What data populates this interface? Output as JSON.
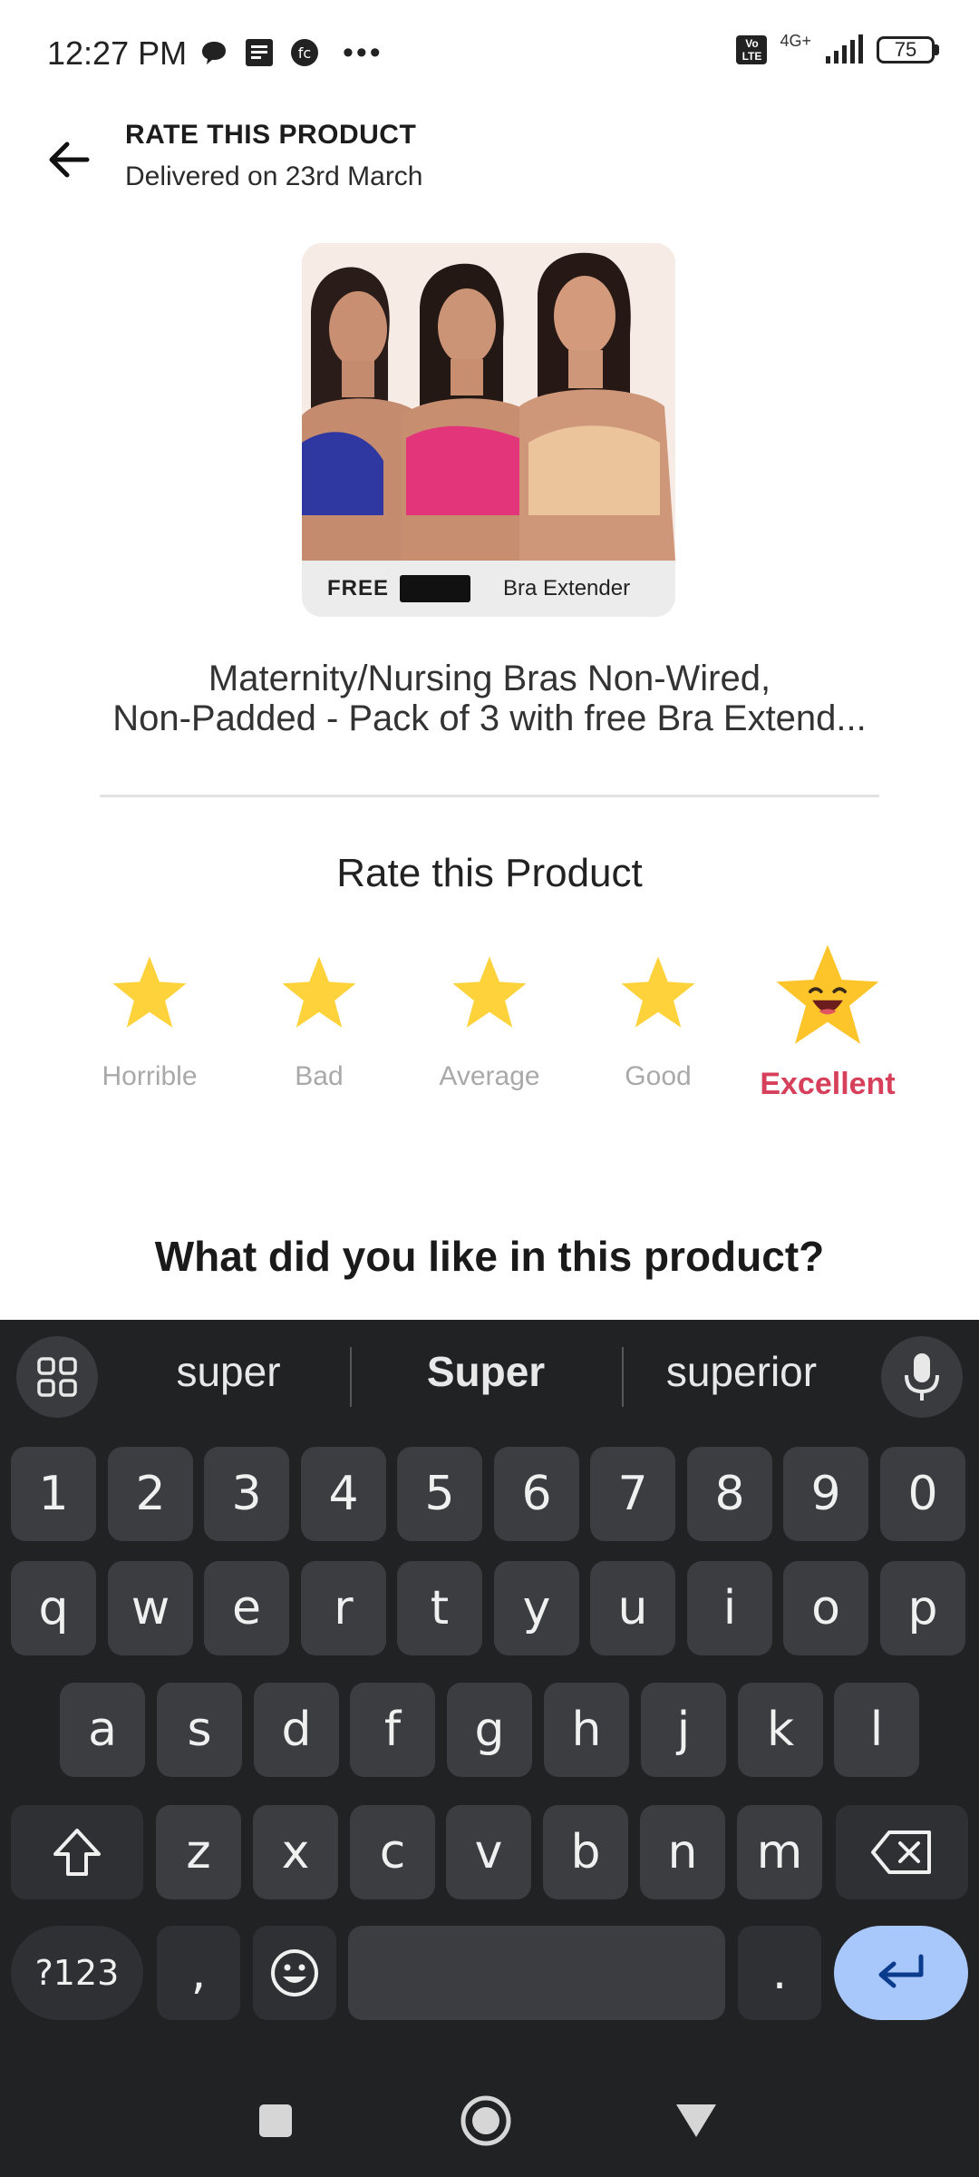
{
  "status_bar": {
    "time": "12:27 PM",
    "network": "4G+",
    "volte": "Vo LTE",
    "battery": "75",
    "icons": [
      "chat-icon",
      "note-icon",
      "circle-app-icon",
      "more-dots-icon"
    ]
  },
  "header": {
    "title": "RATE THIS PRODUCT",
    "subtitle": "Delivered on 23rd March"
  },
  "product": {
    "banner_free": "FREE",
    "banner_text": "Bra Extender",
    "name_line1": "Maternity/Nursing Bras Non-Wired,",
    "name_line2": "Non-Padded - Pack of 3 with free Bra Extend..."
  },
  "rating": {
    "title": "Rate this Product",
    "selected": 5,
    "max": 5,
    "options": [
      {
        "label": "Horrible"
      },
      {
        "label": "Bad"
      },
      {
        "label": "Average"
      },
      {
        "label": "Good"
      },
      {
        "label": "Excellent"
      }
    ]
  },
  "like_question": "What did you like in this product?",
  "keyboard": {
    "suggestions": [
      "super",
      "Super",
      "superior"
    ],
    "row_numbers": [
      "1",
      "2",
      "3",
      "4",
      "5",
      "6",
      "7",
      "8",
      "9",
      "0"
    ],
    "row1": [
      "q",
      "w",
      "e",
      "r",
      "t",
      "y",
      "u",
      "i",
      "o",
      "p"
    ],
    "row2": [
      "a",
      "s",
      "d",
      "f",
      "g",
      "h",
      "j",
      "k",
      "l"
    ],
    "row3": [
      "z",
      "x",
      "c",
      "v",
      "b",
      "n",
      "m"
    ],
    "symbols_key": "?123",
    "comma_key": ",",
    "period_key": "."
  },
  "colors": {
    "accent_excellent": "#d6405b",
    "star": "#fdd23a",
    "keyboard_bg": "#212224",
    "enter_key": "#a8c7fa"
  }
}
